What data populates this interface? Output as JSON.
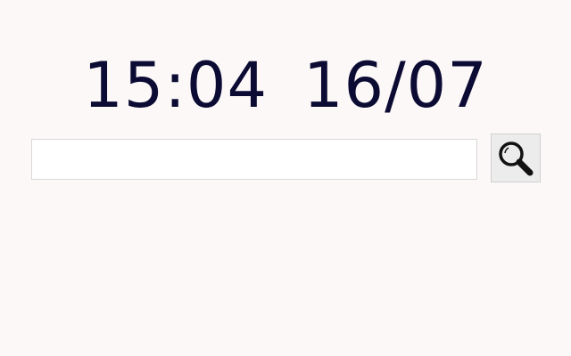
{
  "clock": {
    "time": "15:04",
    "date": "16/07"
  },
  "search": {
    "value": "",
    "placeholder": "",
    "button_icon": "search-icon"
  },
  "colors": {
    "background": "#fcf8f8",
    "clock_text": "#0b0b33",
    "button_background": "#ececec"
  }
}
